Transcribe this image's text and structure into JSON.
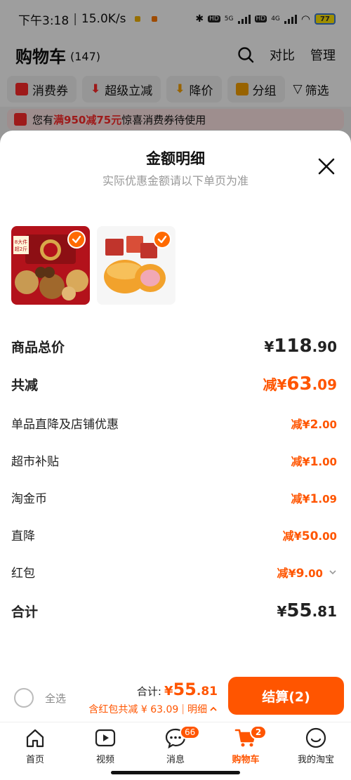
{
  "status_bar": {
    "time": "下午3:18",
    "speed": "15.0K/s",
    "sim1": "5G",
    "sim2": "4G",
    "battery": "77"
  },
  "cart": {
    "title": "购物车",
    "count": "(147)",
    "compare": "对比",
    "manage": "管理"
  },
  "filters": [
    "消费券",
    "超级立减",
    "降价",
    "分组",
    "筛选"
  ],
  "promo": {
    "prefix": "您有",
    "highlight": "满950减75元",
    "suffix": "惊喜消费券待使用"
  },
  "sheet": {
    "title": "金额明细",
    "subtitle": "实际优惠金额请以下单页为准",
    "products": [
      {
        "name": "nut-gift-box",
        "badge_text": "8大件 超2斤"
      },
      {
        "name": "cake-snacks"
      }
    ],
    "rows": [
      {
        "label": "商品总价",
        "prefix": "¥",
        "int": "118",
        "dec": ".90",
        "style": "dark-big"
      },
      {
        "label": "共减",
        "prefix": "减¥",
        "int": "63",
        "dec": ".09",
        "style": "orange-big"
      },
      {
        "label": "单品直降及店铺优惠",
        "prefix": "减¥",
        "int": "2",
        "dec": ".00",
        "style": "orange"
      },
      {
        "label": "超市补贴",
        "prefix": "减¥",
        "int": "1",
        "dec": ".00",
        "style": "orange"
      },
      {
        "label": "淘金币",
        "prefix": "减¥",
        "int": "1",
        "dec": ".09",
        "style": "orange"
      },
      {
        "label": "直降",
        "prefix": "减¥",
        "int": "50",
        "dec": ".00",
        "style": "orange"
      },
      {
        "label": "红包",
        "prefix": "减¥",
        "int": "9",
        "dec": ".00",
        "style": "orange-chevron"
      },
      {
        "label": "合计",
        "prefix": "¥",
        "int": "55",
        "dec": ".81",
        "style": "dark-big"
      }
    ]
  },
  "checkout": {
    "select_all": "全选",
    "total_label": "合计:",
    "total_prefix": "¥",
    "total_int": "55",
    "total_dec": ".81",
    "discount_text": "含红包共减 ¥ 63.09",
    "detail": "明细",
    "pay_button": "结算(2)"
  },
  "tabs": [
    {
      "label": "首页",
      "icon": "home-icon"
    },
    {
      "label": "视频",
      "icon": "video-icon"
    },
    {
      "label": "消息",
      "icon": "message-icon",
      "badge": "66"
    },
    {
      "label": "购物车",
      "icon": "cart-icon",
      "badge": "2",
      "active": true
    },
    {
      "label": "我的淘宝",
      "icon": "profile-icon"
    }
  ],
  "colors": {
    "accent": "#ff5500",
    "promo_red": "#ff2a2a",
    "check_orange": "#ff6a00"
  }
}
